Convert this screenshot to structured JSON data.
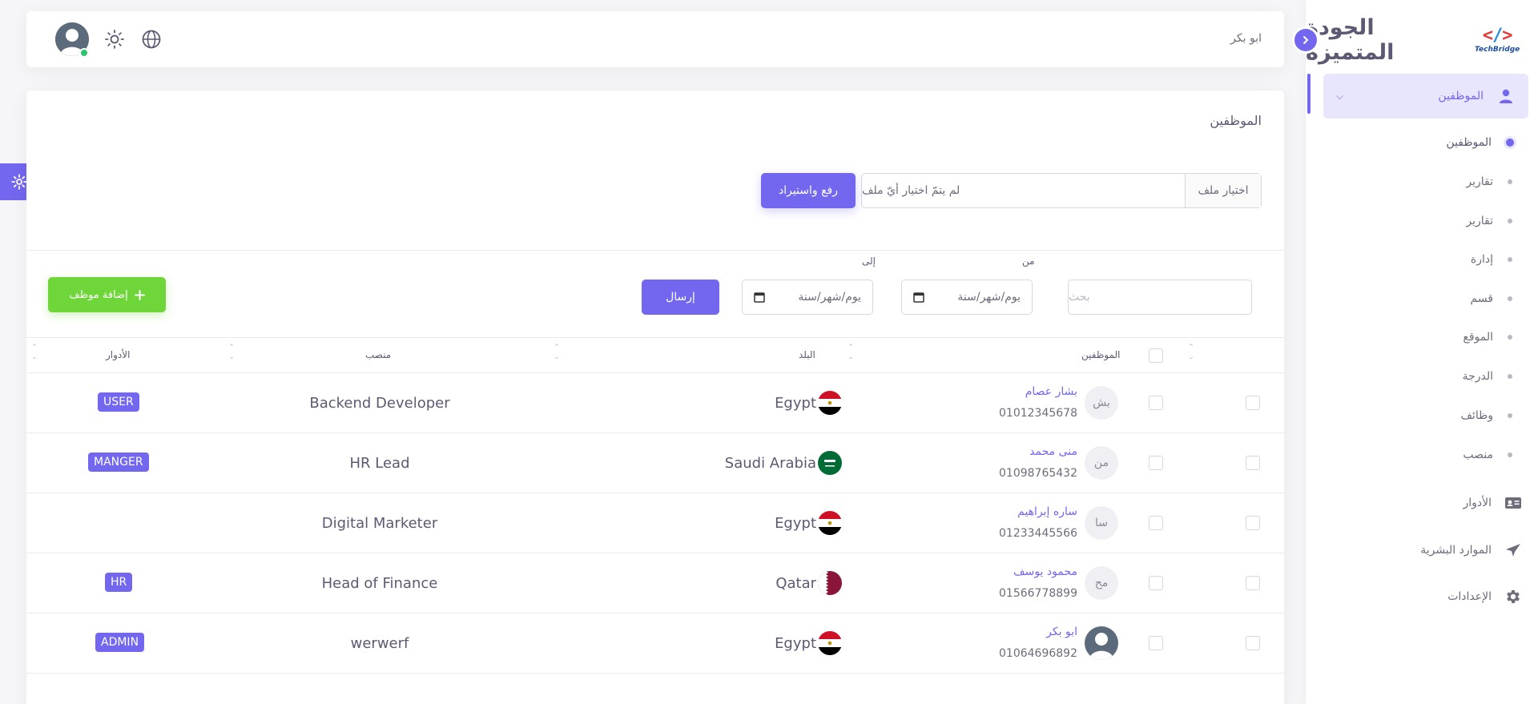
{
  "brand": {
    "name": "الجودة المتميزه",
    "logo_text": "TechBridge"
  },
  "sidebar": {
    "active": {
      "label": "الموظفين"
    },
    "sub_items": [
      {
        "label": "الموظفين"
      },
      {
        "label": "تقارير"
      },
      {
        "label": "تقارير"
      },
      {
        "label": "إدارة"
      },
      {
        "label": "قسم"
      },
      {
        "label": "الموقع"
      },
      {
        "label": "الدرجة"
      },
      {
        "label": "وظائف"
      },
      {
        "label": "منصب"
      }
    ],
    "main_items": [
      {
        "label": "الأدوار",
        "icon": "id-card-icon"
      },
      {
        "label": "الموارد البشرية",
        "icon": "airplane-icon"
      },
      {
        "label": "الإعدادات",
        "icon": "gear-icon"
      }
    ]
  },
  "navbar": {
    "user_name": "ابو بكر"
  },
  "page": {
    "title": "الموظفين"
  },
  "upload": {
    "choose_label": "اختيار ملف",
    "no_file_text": "لم يتمّ اختيار أيّ ملف",
    "button": "رفع واستيراد"
  },
  "filters": {
    "search_placeholder": "بحث",
    "from_label": "من",
    "to_label": "إلى",
    "date_placeholder": "يوم/شهر/سنة",
    "send": "إرسال",
    "add_employee": "إضافة موظف"
  },
  "table": {
    "headers": {
      "employees": "الموظفين",
      "country": "البلد",
      "position": "منصب",
      "roles": "الأدوار"
    },
    "rows": [
      {
        "initials": "بش",
        "name": "بشار عصام",
        "phone": "01012345678",
        "country": "Egypt",
        "flag": "egypt",
        "position": "Backend Developer",
        "role": "USER"
      },
      {
        "initials": "من",
        "name": "منى محمد",
        "phone": "01098765432",
        "country": "Saudi Arabia",
        "flag": "saudi",
        "position": "HR Lead",
        "role": "MANGER"
      },
      {
        "initials": "سا",
        "name": "ساره إبراهيم",
        "phone": "01233445566",
        "country": "Egypt",
        "flag": "egypt",
        "position": "Digital Marketer",
        "role": ""
      },
      {
        "initials": "مح",
        "name": "محمود يوسف",
        "phone": "01566778899",
        "country": "Qatar",
        "flag": "qatar",
        "position": "Head of Finance",
        "role": "HR"
      },
      {
        "initials": "",
        "name": "ابو بكر",
        "phone": "01064696892",
        "country": "Egypt",
        "flag": "egypt",
        "position": "werwerf",
        "role": "ADMIN"
      }
    ]
  },
  "colors": {
    "primary": "#7367f0",
    "success": "#6fd63a"
  }
}
